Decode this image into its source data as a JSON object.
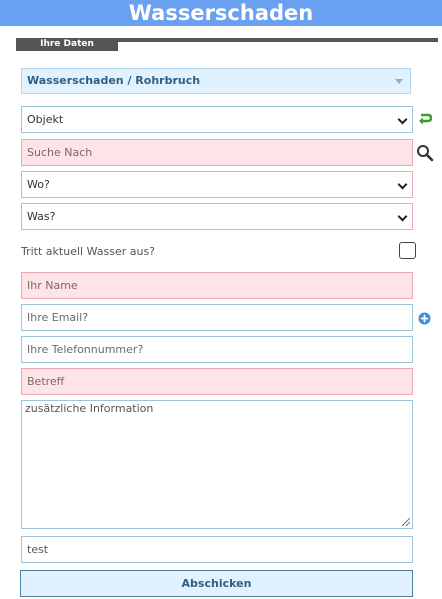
{
  "header": {
    "title": "Wasserschaden"
  },
  "section": {
    "tab_label": "Ihre Daten"
  },
  "category": {
    "selected": "Wasserschaden / Rohrbruch"
  },
  "form": {
    "objekt_select": "Objekt",
    "suche_nach_placeholder": "Suche Nach",
    "wo_select": "Wo?",
    "was_select": "Was?",
    "wasser_question": "Tritt aktuell Wasser aus?",
    "name_placeholder": "Ihr Name",
    "email_placeholder": "Ihre Email?",
    "telefon_placeholder": "Ihre Telefonnummer?",
    "betreff_placeholder": "Betreff",
    "info_placeholder": "zusätzliche Information",
    "extra_value": "test",
    "submit_label": "Abschicken"
  },
  "icons": {
    "reset": "green-undo-arrow-icon",
    "search": "magnifier-icon",
    "add": "blue-plus-circle-icon"
  },
  "colors": {
    "banner": "#6aa0f2",
    "required_field_bg": "#fde4e6",
    "accent_blue": "#2f5f83",
    "reset_green": "#3c9a2a"
  }
}
